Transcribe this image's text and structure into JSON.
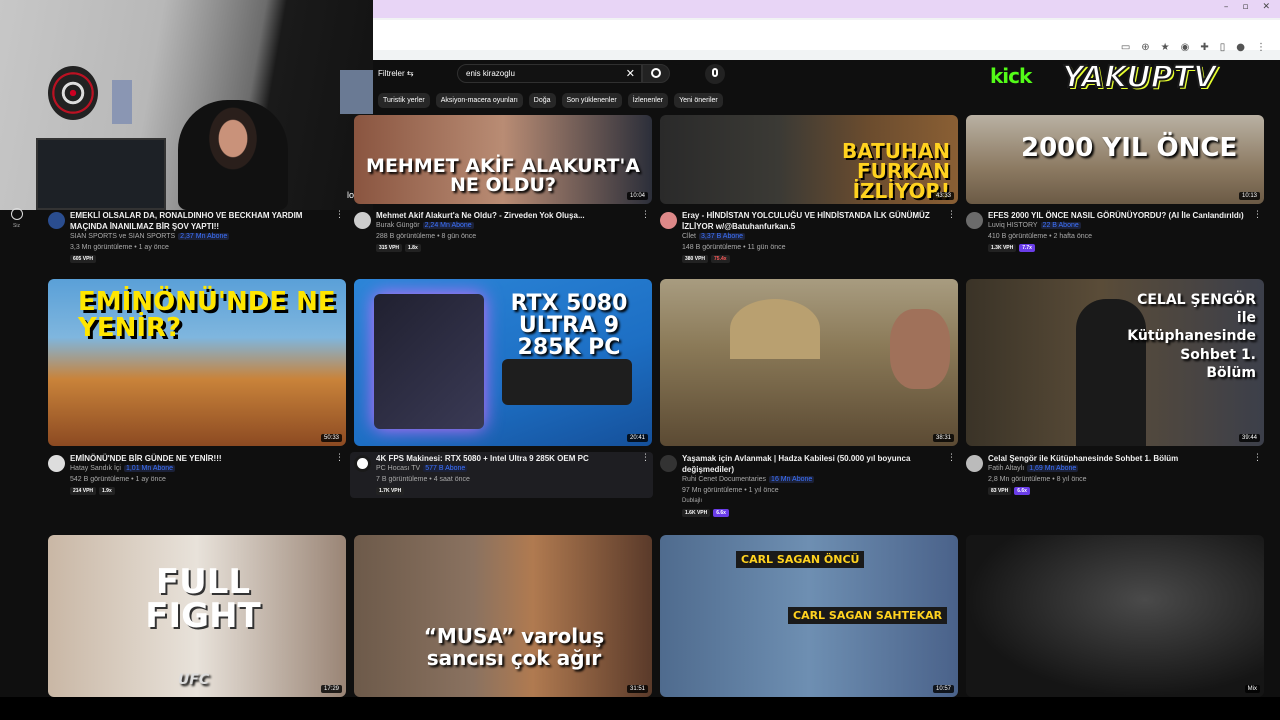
{
  "header": {
    "filters_label": "Filtreler ⇆",
    "search_value": "enis kirazoglu",
    "chips": [
      "Turistik yerler",
      "Aksiyon-macera oyunları",
      "Doğa",
      "Son yüklenenler",
      "İzlenenler",
      "Yeni öneriler"
    ]
  },
  "overlay": {
    "kick": "kick",
    "yakup": "YAKUPTV"
  },
  "webcam": {
    "logi": "logi"
  },
  "rail": {
    "label": "Siz"
  },
  "videos": [
    {
      "title": "EMEKLİ OLSALAR DA, RONALDINHO VE BECKHAM YARDIM MAÇINDA İNANILMAZ BİR ŞOV YAPTI!!",
      "channel": "SIAN SPORTS ve SIAN SPORTS",
      "subs": "2,37 Mn Abone",
      "stats": "3,3 Mn görüntüleme • 1 ay önce",
      "badge1": "605 VPH",
      "badge2": "",
      "duration": "",
      "thumb_text": ""
    },
    {
      "title": "Mehmet Akif Alakurt'a Ne Oldu? - Zirveden Yok Oluşa...",
      "channel": "Burak Güngör",
      "subs": "2,24 Mn Abone",
      "stats": "288 B görüntüleme • 8 gün önce",
      "badge1": "315 VPH",
      "badge2": "1.8x",
      "duration": "10:04",
      "thumb_text": "MEHMET AKİF ALAKURT'A NE OLDU?"
    },
    {
      "title": "Eray - HİNDİSTAN YOLCULUĞU VE HİNDİSTANDA İLK GÜNÜMÜZ İZLİYOR w/@Batuhanfurkan.5",
      "channel": "Cllet",
      "subs": "3,37 B Abone",
      "stats": "148 B görüntüleme • 11 gün önce",
      "badge1": "380 VPH",
      "badge2": "75.4x",
      "duration": "43:33",
      "thumb_text": "BATUHAN FURKAN İZLİYOR!"
    },
    {
      "title": "EFES 2000 YIL ÖNCE NASIL GÖRÜNÜYORDU? (AI İle Canlandırıldı)",
      "channel": "Luviq HISTORY",
      "subs": "22 B Abone",
      "stats": "410 B görüntüleme • 2 hafta önce",
      "badge1": "1.3K VPH",
      "badge2": "7.7x",
      "duration": "10:13",
      "thumb_text": "2000 YIL ÖNCE"
    },
    {
      "title": "EMİNÖNÜ'NDE BİR GÜNDE NE YENİR!!!",
      "channel": "Hatay Sandık İçi",
      "subs": "1,01 Mn Abone",
      "stats": "542 B görüntüleme • 1 ay önce",
      "badge1": "214 VPH",
      "badge2": "1.9x",
      "duration": "50:33",
      "thumb_text": "EMİNÖNÜ'NDE NE YENİR?"
    },
    {
      "title": "4K FPS Makinesi: RTX 5080 + Intel Ultra 9 285K OEM PC",
      "channel": "PC Hocası TV",
      "subs": "577 B Abone",
      "stats": "7 B görüntüleme • 4 saat önce",
      "badge1": "1.7K VPH",
      "badge2": "",
      "duration": "20:41",
      "thumb_text": "RTX 5080 ULTRA 9 285K PC"
    },
    {
      "title": "Yaşamak için Avlanmak | Hadza Kabilesi (50.000 yıl boyunca değişmediler)",
      "channel": "Ruhi Cenet Documentaries",
      "subs": "16 Mn Abone",
      "stats": "97 Mn görüntüleme • 1 yıl önce",
      "badge1": "1.6K VPH",
      "badge2": "6.6x",
      "duration": "38:31",
      "thumb_text": "",
      "dub": "Dublajlı"
    },
    {
      "title": "Celal Şengör ile Kütüphanesinde Sohbet 1. Bölüm",
      "channel": "Fatih Altaylı",
      "subs": "1,69 Mn Abone",
      "stats": "2,8 Mn görüntüleme • 8 yıl önce",
      "badge1": "83 VPH",
      "badge2": "6.6x",
      "duration": "39:44",
      "thumb_text": "CELAL ŞENGÖR ile Kütüphanesinde Sohbet 1. Bölüm"
    },
    {
      "duration": "17:29",
      "thumb_text": "FULL FIGHT",
      "tag": "UFC"
    },
    {
      "duration": "31:51",
      "thumb_text": "“MUSA” varoluş sancısı çok ağır"
    },
    {
      "duration": "10:57",
      "thumb_text": "CARL SAGAN ÖNCÜ",
      "thumb_text2": "CARL SAGAN SAHTEKAR"
    },
    {
      "duration": "",
      "thumb_text": "",
      "mix": "Mix"
    }
  ],
  "colors": {
    "accent": "#3d73ff",
    "kick": "#53fc18",
    "purple": "#6a3de8"
  }
}
